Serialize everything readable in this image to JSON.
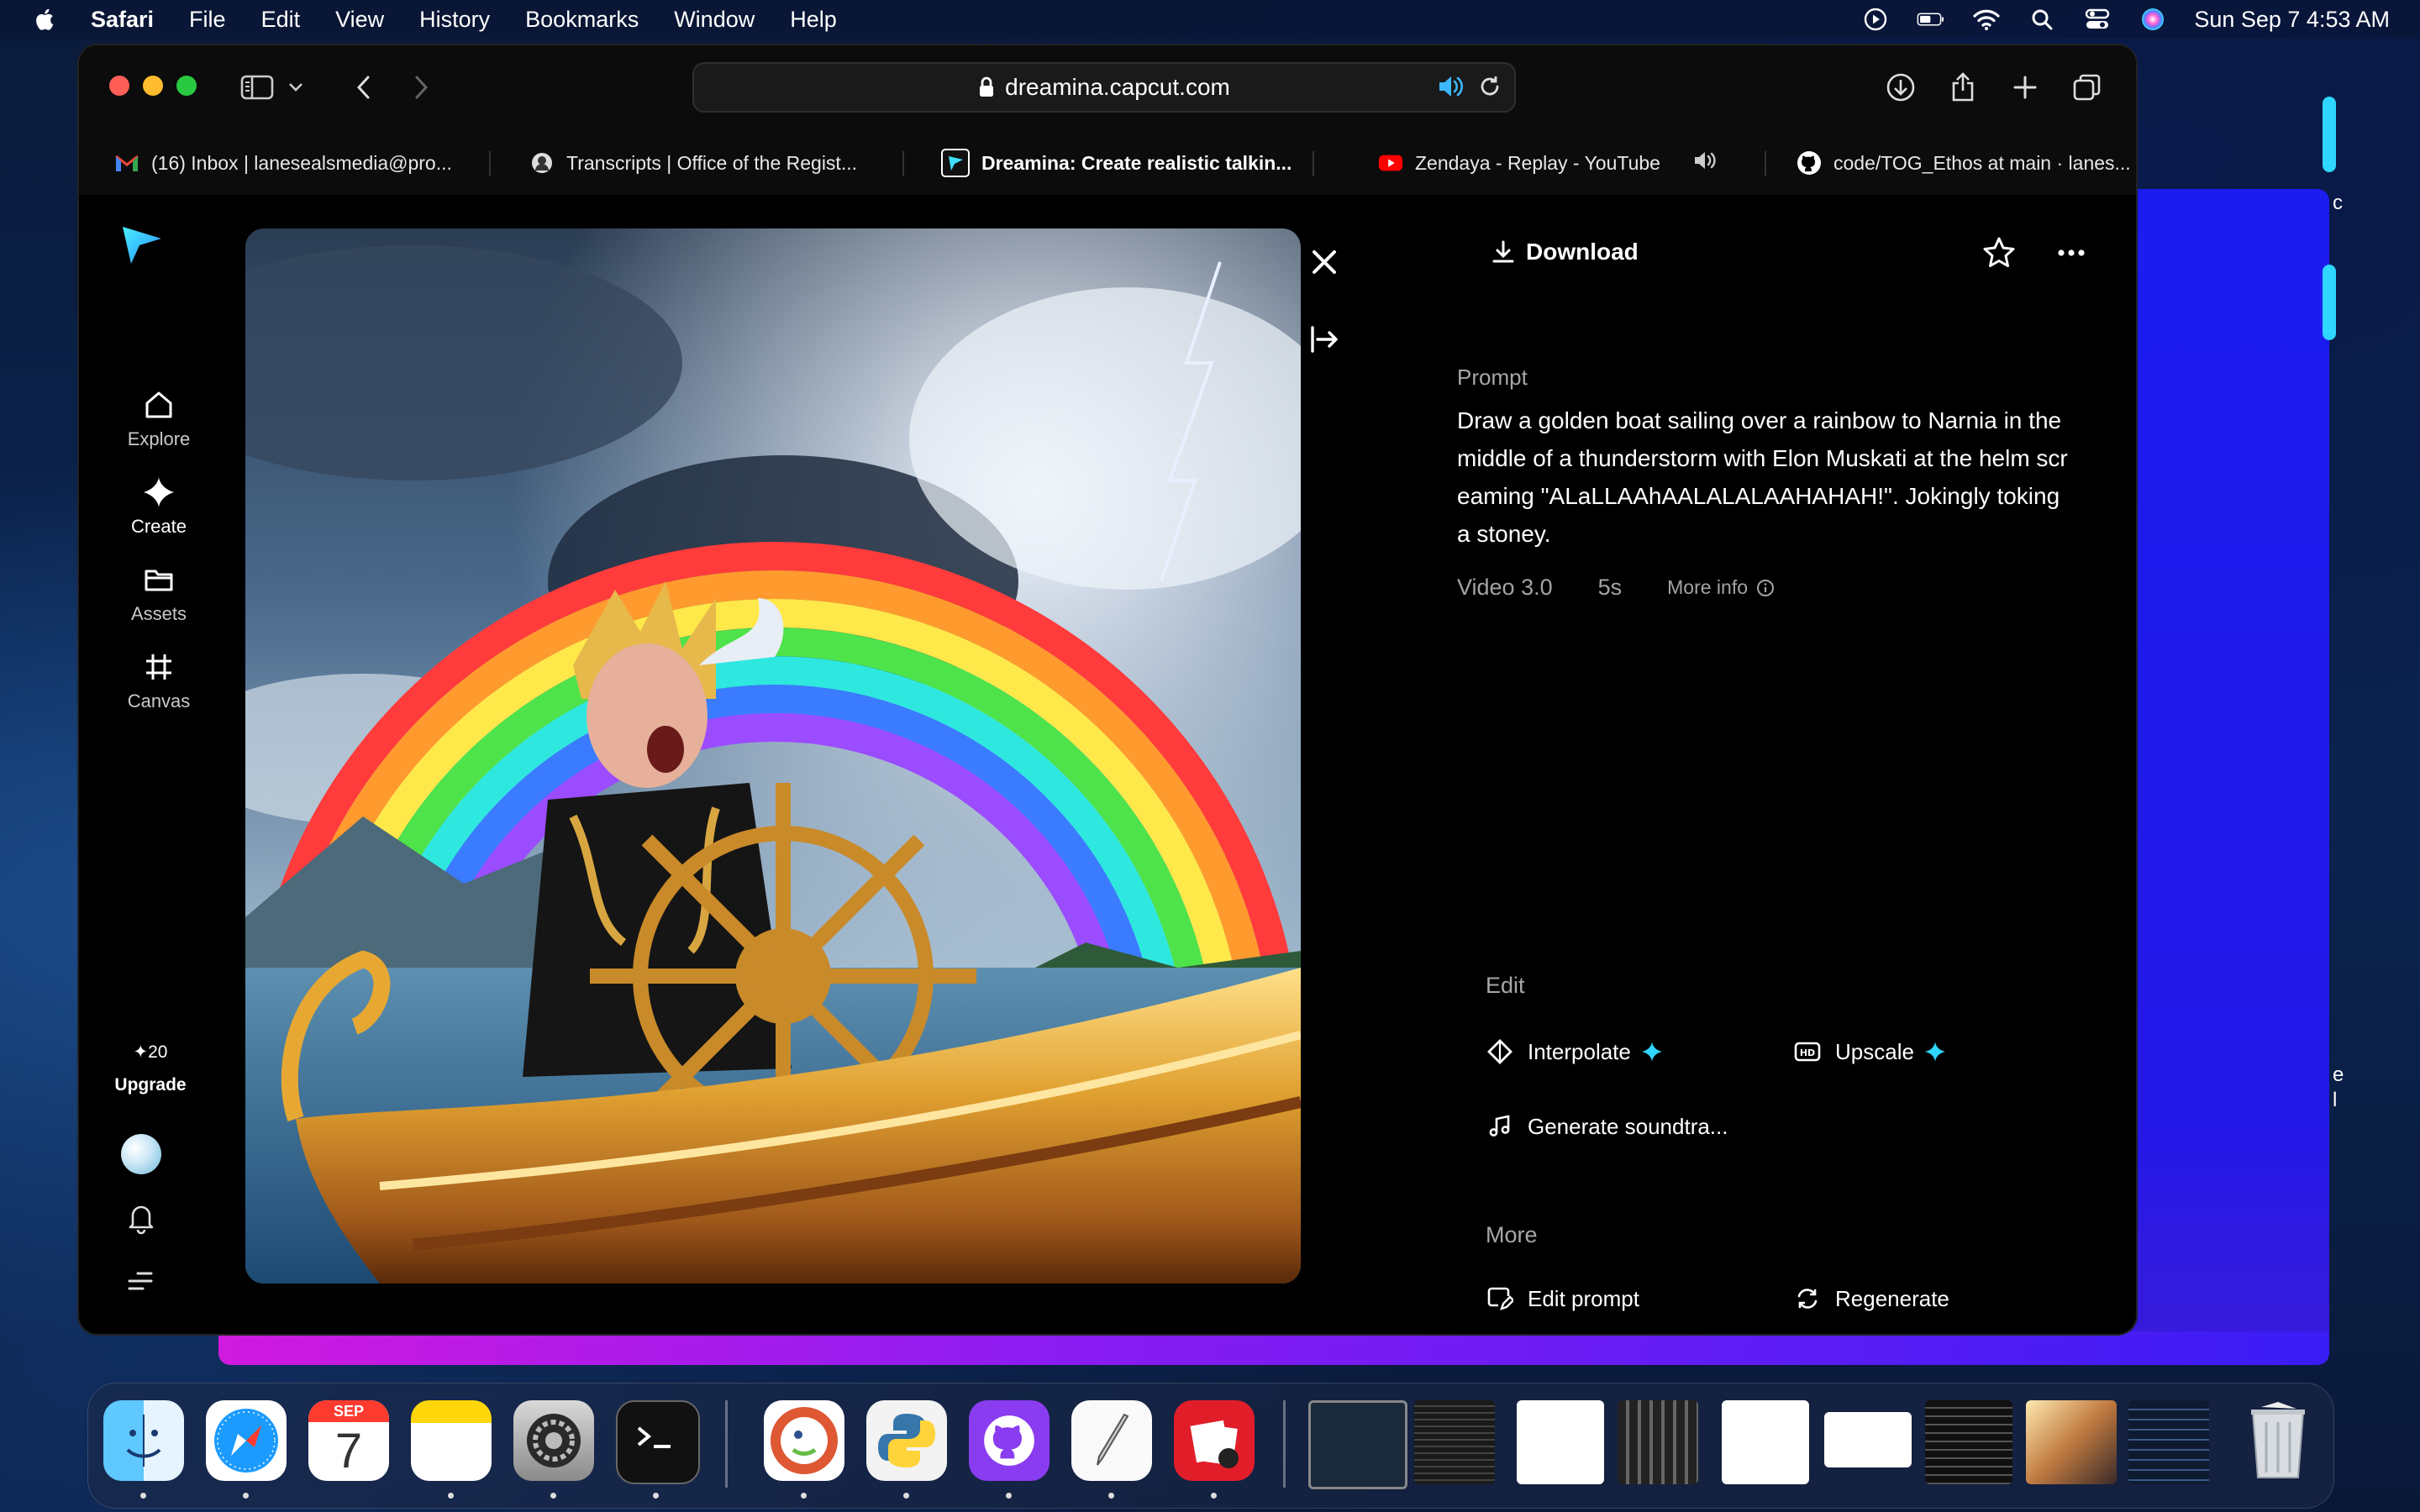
{
  "menubar": {
    "app_name": "Safari",
    "items": [
      "File",
      "Edit",
      "View",
      "History",
      "Bookmarks",
      "Window",
      "Help"
    ],
    "datetime": "Sun Sep 7  4:53 AM"
  },
  "browser": {
    "url": "dreamina.capcut.com",
    "tabs": [
      {
        "title": "(16) Inbox | lanesealsmedia@pro...",
        "icon": "gmail-icon"
      },
      {
        "title": "Transcripts | Office of the Regist...",
        "icon": "site-icon"
      },
      {
        "title": "Dreamina: Create realistic talkin...",
        "icon": "dreamina-icon",
        "active": true
      },
      {
        "title": "Zendaya - Replay - YouTube",
        "icon": "youtube-icon"
      },
      {
        "title": "code/TOG_Ethos at main · lanes...",
        "icon": "github-icon"
      }
    ]
  },
  "sidebar": {
    "nav": [
      {
        "label": "Explore",
        "icon": "home-icon"
      },
      {
        "label": "Create",
        "icon": "sparkle-icon"
      },
      {
        "label": "Assets",
        "icon": "folder-icon"
      },
      {
        "label": "Canvas",
        "icon": "canvas-icon"
      }
    ],
    "credits": "20",
    "upgrade_label": "Upgrade"
  },
  "details": {
    "download_label": "Download",
    "prompt_label": "Prompt",
    "prompt_text": "Draw a golden boat sailing over a rainbow to Narnia in the middle of a thunderstorm with Elon Muskati at the helm screaming \"ALaLLAAhAALALALAAHAHAH!\". Jokingly toking a stoney.",
    "model": "Video 3.0",
    "duration": "5s",
    "more_info_label": "More info",
    "edit_label": "Edit",
    "edit_actions": [
      {
        "label": "Interpolate",
        "icon": "interpolate-icon"
      },
      {
        "label": "Upscale",
        "icon": "hd-icon"
      },
      {
        "label": "Generate soundtra...",
        "icon": "music-note-icon"
      }
    ],
    "more_label": "More",
    "more_actions": [
      {
        "label": "Edit prompt",
        "icon": "edit-prompt-icon"
      },
      {
        "label": "Regenerate",
        "icon": "regenerate-icon"
      }
    ]
  },
  "dock": {
    "calendar_month": "SEP",
    "calendar_day": "7"
  },
  "colors": {
    "accent_cyan": "#2fd6ff",
    "bg_window_blue": "#1b1cf0",
    "red": "#ff5f57",
    "yellow": "#febc2e",
    "green": "#28c840"
  }
}
